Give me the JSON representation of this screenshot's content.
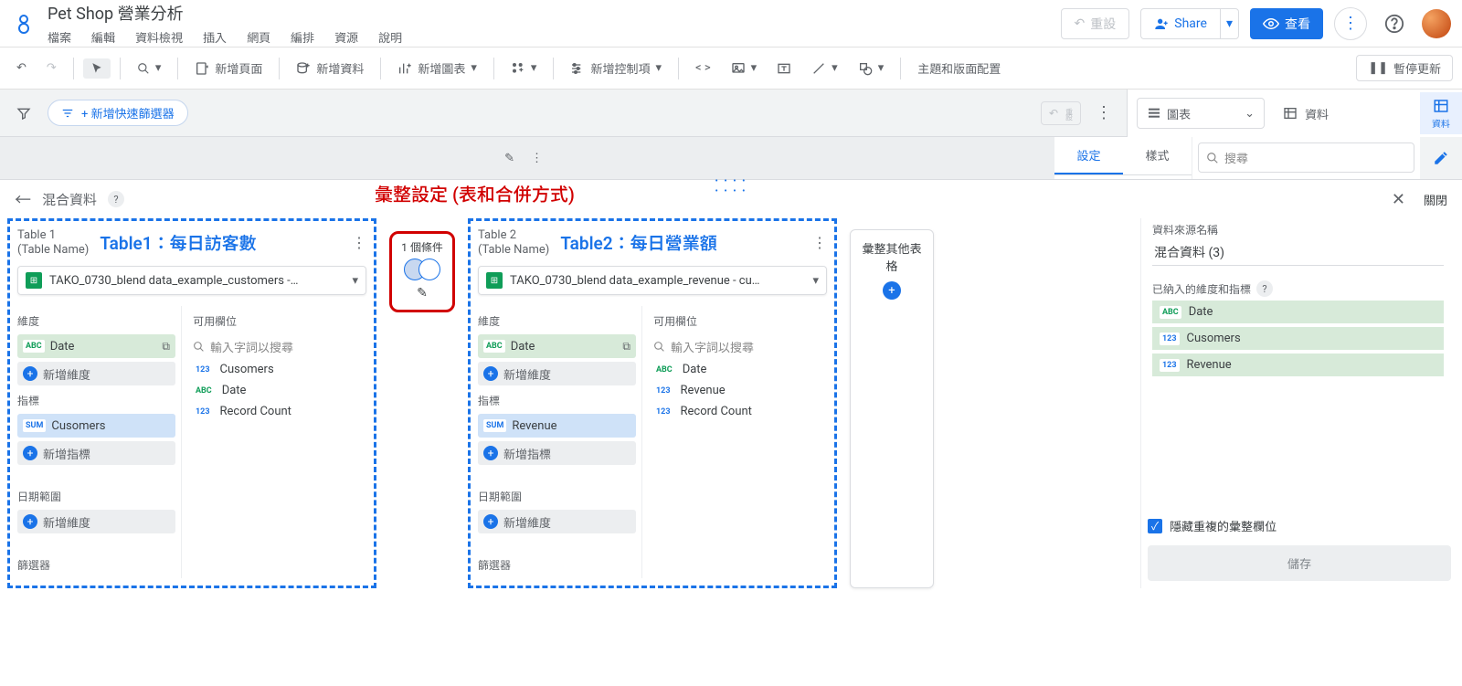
{
  "header": {
    "title": "Pet Shop 營業分析",
    "menus": [
      "檔案",
      "編輯",
      "資料檢視",
      "插入",
      "網頁",
      "編排",
      "資源",
      "說明"
    ],
    "reset": "重設",
    "share": "Share",
    "view": "查看"
  },
  "toolbar": {
    "add_page": "新增頁面",
    "add_data": "新增資料",
    "add_chart": "新增圖表",
    "add_control": "新增控制項",
    "theme": "主題和版面配置",
    "pause": "暫停更新"
  },
  "filterbar": {
    "quickfilter": "+ 新增快速篩選器",
    "reset_short": "重設"
  },
  "props": {
    "chart_label": "圖表",
    "data_label": "資料",
    "tab_settings": "設定",
    "tab_style": "樣式",
    "search_placeholder": "搜尋",
    "rail_data": "資料"
  },
  "blend": {
    "panel_title": "混合資料",
    "close": "關閉",
    "annotation": "彙整設定 (表和合併方式)",
    "join_count": "1 個條件",
    "agg_other": "彙整其他表格",
    "right": {
      "name_label": "資料來源名稱",
      "name_value": "混合資料 (3)",
      "included_label": "已納入的維度和指標",
      "fields": [
        {
          "badge": "ABC",
          "cls": "abc",
          "label": "Date"
        },
        {
          "badge": "123",
          "cls": "num123",
          "label": "Cusomers"
        },
        {
          "badge": "123",
          "cls": "num123",
          "label": "Revenue"
        }
      ],
      "hide_dup": "隱藏重複的彙整欄位",
      "save": "儲存"
    },
    "tables": [
      {
        "id": "Table 1",
        "tname_sub": "(Table Name)",
        "biglabel": "Table1：每日訪客數",
        "datasource": "TAKO_0730_blend data_example_customers -…",
        "dim_label": "維度",
        "dim": {
          "badge": "ABC",
          "cls": "abc",
          "text": "Date"
        },
        "add_dim": "新增維度",
        "metric_label": "指標",
        "metric": {
          "badge": "SUM",
          "cls": "sum",
          "text": "Cusomers"
        },
        "add_metric": "新增指標",
        "daterange_label": "日期範圍",
        "add_daterange": "新增維度",
        "filter_label": "篩選器",
        "avail_label": "可用欄位",
        "search_placeholder": "輸入字詞以搜尋",
        "avail": [
          {
            "badge": "123",
            "cls": "num123",
            "label": "Cusomers"
          },
          {
            "badge": "ABC",
            "cls": "abc",
            "label": "Date"
          },
          {
            "badge": "123",
            "cls": "num123",
            "label": "Record Count"
          }
        ]
      },
      {
        "id": "Table 2",
        "tname_sub": "(Table Name)",
        "biglabel": "Table2：每日營業額",
        "datasource": "TAKO_0730_blend data_example_revenue - cu…",
        "dim_label": "維度",
        "dim": {
          "badge": "ABC",
          "cls": "abc",
          "text": "Date"
        },
        "add_dim": "新增維度",
        "metric_label": "指標",
        "metric": {
          "badge": "SUM",
          "cls": "sum",
          "text": "Revenue"
        },
        "add_metric": "新增指標",
        "daterange_label": "日期範圍",
        "add_daterange": "新增維度",
        "filter_label": "篩選器",
        "avail_label": "可用欄位",
        "search_placeholder": "輸入字詞以搜尋",
        "avail": [
          {
            "badge": "ABC",
            "cls": "abc",
            "label": "Date"
          },
          {
            "badge": "123",
            "cls": "num123",
            "label": "Revenue"
          },
          {
            "badge": "123",
            "cls": "num123",
            "label": "Record Count"
          }
        ]
      }
    ]
  }
}
